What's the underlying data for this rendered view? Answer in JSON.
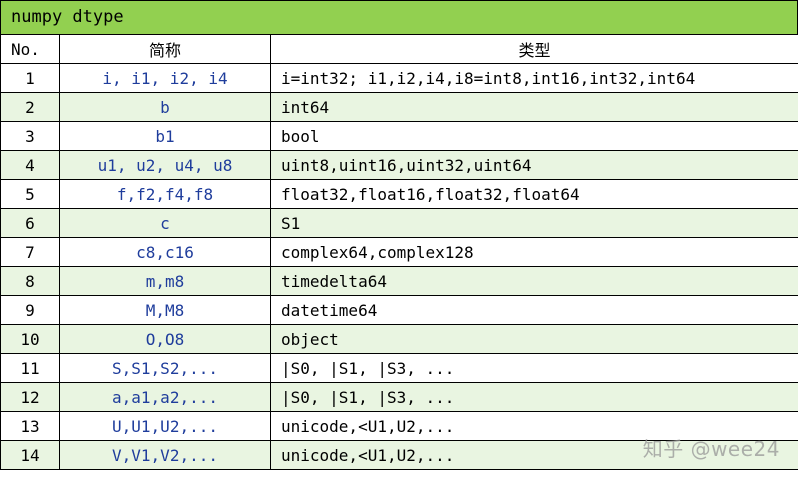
{
  "title": "numpy dtype",
  "headers": {
    "no": "No.",
    "abbr": "简称",
    "type": "类型"
  },
  "rows": [
    {
      "no": "1",
      "abbr": "i, i1, i2, i4",
      "type": "i=int32; i1,i2,i4,i8=int8,int16,int32,int64"
    },
    {
      "no": "2",
      "abbr": "b",
      "type": "int64"
    },
    {
      "no": "3",
      "abbr": "b1",
      "type": "bool"
    },
    {
      "no": "4",
      "abbr": "u1, u2, u4, u8",
      "type": "uint8,uint16,uint32,uint64"
    },
    {
      "no": "5",
      "abbr": "f,f2,f4,f8",
      "type": "float32,float16,float32,float64"
    },
    {
      "no": "6",
      "abbr": "c",
      "type": "S1"
    },
    {
      "no": "7",
      "abbr": "c8,c16",
      "type": "complex64,complex128"
    },
    {
      "no": "8",
      "abbr": "m,m8",
      "type": "timedelta64"
    },
    {
      "no": "9",
      "abbr": "M,M8",
      "type": "datetime64"
    },
    {
      "no": "10",
      "abbr": "O,O8",
      "type": "object"
    },
    {
      "no": "11",
      "abbr": "S,S1,S2,...",
      "type": "|S0, |S1, |S3, ..."
    },
    {
      "no": "12",
      "abbr": "a,a1,a2,...",
      "type": "|S0, |S1, |S3, ..."
    },
    {
      "no": "13",
      "abbr": "U,U1,U2,...",
      "type": "unicode,<U1,U2,..."
    },
    {
      "no": "14",
      "abbr": "V,V1,V2,...",
      "type": "unicode,<U1,U2,..."
    }
  ],
  "watermark": "知乎 @wee24",
  "colors": {
    "header_bg": "#92d050",
    "alt_row_bg": "#e9f5e1",
    "abbr_text": "#1f3d9c"
  }
}
